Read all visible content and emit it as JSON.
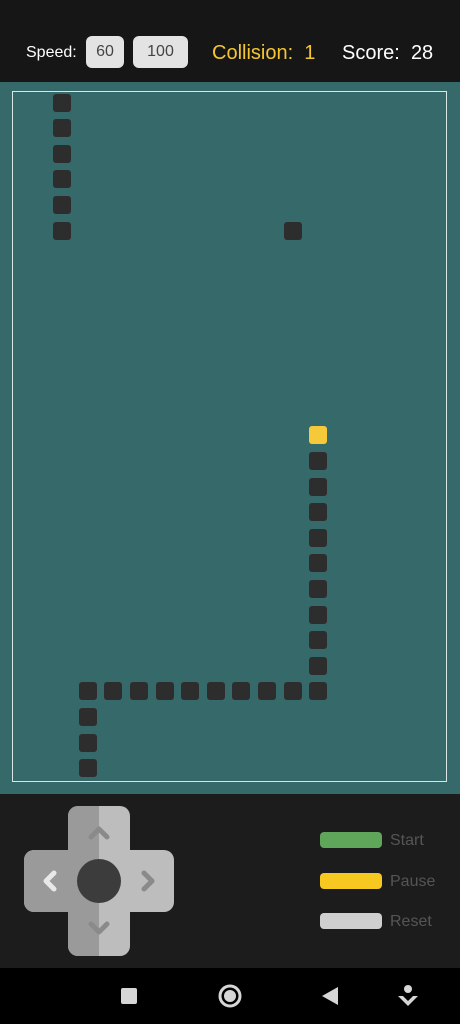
{
  "header": {
    "speed_label": "Speed:",
    "speed_options": [
      "60",
      "100"
    ],
    "collision_label": "Collision:",
    "collision_value": "1",
    "score_label": "Score:",
    "score_value": "28"
  },
  "game": {
    "grid_cols": 17,
    "grid_rows": 27,
    "snake_head": [
      11,
      13
    ],
    "snake_body": [
      [
        11,
        14
      ],
      [
        11,
        15
      ],
      [
        11,
        16
      ],
      [
        11,
        17
      ],
      [
        11,
        18
      ],
      [
        11,
        19
      ],
      [
        11,
        20
      ],
      [
        11,
        21
      ],
      [
        11,
        22
      ],
      [
        11,
        23
      ],
      [
        10,
        23
      ],
      [
        9,
        23
      ],
      [
        8,
        23
      ],
      [
        7,
        23
      ],
      [
        6,
        23
      ],
      [
        5,
        23
      ],
      [
        4,
        23
      ],
      [
        3,
        23
      ],
      [
        2,
        23
      ],
      [
        2,
        24
      ],
      [
        2,
        25
      ],
      [
        2,
        26
      ]
    ],
    "other_blocks": [
      [
        1,
        0
      ],
      [
        1,
        1
      ],
      [
        1,
        2
      ],
      [
        1,
        3
      ],
      [
        1,
        4
      ],
      [
        1,
        5
      ]
    ],
    "food": [
      10,
      5
    ]
  },
  "controls": {
    "dpad_icons": [
      "arrow-up-icon",
      "arrow-down-icon",
      "arrow-left-icon",
      "arrow-right-icon"
    ],
    "legend": [
      {
        "label": "Start",
        "color": "#5fa55a"
      },
      {
        "label": "Pause",
        "color": "#f6c820"
      },
      {
        "label": "Reset",
        "color": "#cfcfcf"
      }
    ]
  },
  "colors": {
    "field": "#36696a",
    "block": "#2d2d2d",
    "head": "#f6c93a",
    "collision": "#f4c631"
  },
  "navigation": {
    "icons": [
      "recents-square-icon",
      "home-circle-icon",
      "back-triangle-icon",
      "assistant-icon"
    ]
  }
}
